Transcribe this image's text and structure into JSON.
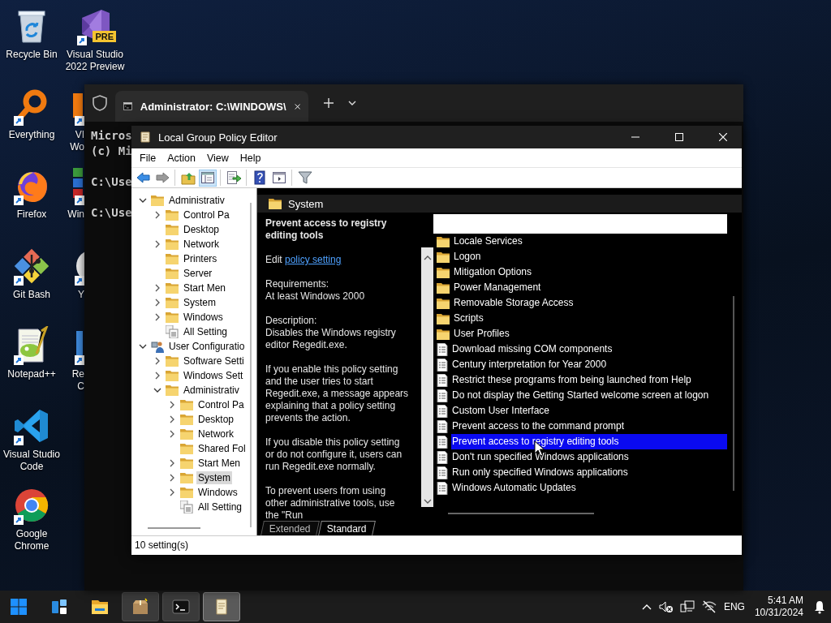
{
  "desktop": {
    "icons": [
      {
        "lines": [
          "Recycle Bin"
        ],
        "kind": "recycle-bin",
        "shortcut": false
      },
      {
        "lines": [
          "Everything"
        ],
        "kind": "everything",
        "shortcut": true
      },
      {
        "lines": [
          "Firefox"
        ],
        "kind": "firefox",
        "shortcut": true
      },
      {
        "lines": [
          "Git Bash"
        ],
        "kind": "git-bash",
        "shortcut": true
      },
      {
        "lines": [
          "Notepad++"
        ],
        "kind": "notepad-plus",
        "shortcut": true
      },
      {
        "lines": [
          "Visual Studio",
          "Code"
        ],
        "kind": "vscode",
        "shortcut": true
      },
      {
        "lines": [
          "Google",
          "Chrome"
        ],
        "kind": "chrome",
        "shortcut": true
      }
    ],
    "second_column": [
      {
        "lines": [
          "Visual Studio",
          "2022 Preview"
        ],
        "kind": "vs-preview",
        "badge": "PRE",
        "shortcut": true
      }
    ],
    "covered_icons": [
      {
        "lines": [
          "VI",
          "Wo"
        ],
        "kind": "ring",
        "shortcut": true
      },
      {
        "lines": [
          "Win"
        ],
        "kind": "tiles",
        "shortcut": true
      },
      {
        "lines": [
          "Y"
        ],
        "kind": "disc",
        "shortcut": true
      },
      {
        "lines": [
          "Re",
          "C"
        ],
        "kind": "panel",
        "shortcut": true
      }
    ]
  },
  "terminal": {
    "tab_title": "Administrator: C:\\WINDOWS\\",
    "blocks": [
      [
        "Micros",
        "(c) Mi"
      ],
      [
        "C:\\Use"
      ],
      [
        "C:\\Use"
      ]
    ]
  },
  "gpo": {
    "title": "Local Group Policy Editor",
    "menu": [
      "File",
      "Action",
      "View",
      "Help"
    ],
    "toolbar": [
      [
        {
          "kind": "back",
          "pressed": false
        },
        {
          "kind": "forward",
          "pressed": false
        }
      ],
      [
        {
          "kind": "up",
          "pressed": false
        },
        {
          "kind": "tree-toggle",
          "pressed": true
        }
      ],
      [
        {
          "kind": "export",
          "pressed": false
        }
      ],
      [
        {
          "kind": "help",
          "pressed": false
        },
        {
          "kind": "view",
          "pressed": false
        }
      ],
      [
        {
          "kind": "filter",
          "pressed": false
        }
      ]
    ],
    "tree": [
      {
        "label": "Administrativ",
        "kind": "folder",
        "expanded": true,
        "selected": false,
        "children": [
          {
            "label": "Control Pa",
            "kind": "folder",
            "expanded": false,
            "selected": false
          },
          {
            "label": "Desktop",
            "kind": "folder",
            "selected": false
          },
          {
            "label": "Network",
            "kind": "folder",
            "expanded": false,
            "selected": false
          },
          {
            "label": "Printers",
            "kind": "folder",
            "selected": false
          },
          {
            "label": "Server",
            "kind": "folder",
            "selected": false
          },
          {
            "label": "Start Men",
            "kind": "folder",
            "expanded": false,
            "selected": false
          },
          {
            "label": "System",
            "kind": "folder",
            "expanded": false,
            "selected": false
          },
          {
            "label": "Windows",
            "kind": "folder",
            "expanded": false,
            "selected": false
          },
          {
            "label": "All Setting",
            "kind": "all-settings",
            "selected": false
          }
        ]
      },
      {
        "label": "User Configuratio",
        "kind": "user",
        "expanded": true,
        "selected": false,
        "children": [
          {
            "label": "Software Setti",
            "kind": "folder",
            "expanded": false,
            "selected": false
          },
          {
            "label": "Windows Sett",
            "kind": "folder",
            "expanded": false,
            "selected": false
          },
          {
            "label": "Administrativ",
            "kind": "folder",
            "expanded": true,
            "selected": false,
            "children": [
              {
                "label": "Control Pa",
                "kind": "folder",
                "expanded": false,
                "selected": false
              },
              {
                "label": "Desktop",
                "kind": "folder",
                "expanded": false,
                "selected": false
              },
              {
                "label": "Network",
                "kind": "folder",
                "expanded": false,
                "selected": false
              },
              {
                "label": "Shared Fol",
                "kind": "folder",
                "selected": false
              },
              {
                "label": "Start Men",
                "kind": "folder",
                "expanded": false,
                "selected": false
              },
              {
                "label": "System",
                "kind": "folder",
                "expanded": false,
                "selected": true
              },
              {
                "label": "Windows",
                "kind": "folder",
                "expanded": false,
                "selected": false
              },
              {
                "label": "All Setting",
                "kind": "all-settings",
                "selected": false
              }
            ]
          }
        ]
      }
    ],
    "header": "System",
    "details": {
      "title": "Prevent access to registry editing tools",
      "edit": "Edit",
      "link": "policy setting",
      "sections": [
        {
          "heading": "Requirements:",
          "text": "At least Windows 2000"
        },
        {
          "heading": "Description:",
          "text": "Disables the Windows registry editor Regedit.exe."
        }
      ],
      "paragraphs": [
        "If you enable this policy setting and the user tries to start Regedit.exe, a message appears explaining that a policy setting prevents the action.",
        "If you disable this policy setting or do not configure it, users can run Regedit.exe normally.",
        "To prevent users from using other administrative tools, use the \"Run"
      ]
    },
    "items": [
      {
        "label": "Locale Services",
        "kind": "folder",
        "selected": false
      },
      {
        "label": "Logon",
        "kind": "folder",
        "selected": false
      },
      {
        "label": "Mitigation Options",
        "kind": "folder",
        "selected": false
      },
      {
        "label": "Power Management",
        "kind": "folder",
        "selected": false
      },
      {
        "label": "Removable Storage Access",
        "kind": "folder",
        "selected": false
      },
      {
        "label": "Scripts",
        "kind": "folder",
        "selected": false
      },
      {
        "label": "User Profiles",
        "kind": "folder",
        "selected": false
      },
      {
        "label": "Download missing COM components",
        "kind": "setting",
        "selected": false
      },
      {
        "label": "Century interpretation for Year 2000",
        "kind": "setting",
        "selected": false
      },
      {
        "label": "Restrict these programs from being launched from Help",
        "kind": "setting",
        "selected": false
      },
      {
        "label": "Do not display the Getting Started welcome screen at logon",
        "kind": "setting",
        "selected": false
      },
      {
        "label": "Custom User Interface",
        "kind": "setting",
        "selected": false
      },
      {
        "label": "Prevent access to the command prompt",
        "kind": "setting",
        "selected": false
      },
      {
        "label": "Prevent access to registry editing tools",
        "kind": "setting",
        "selected": true
      },
      {
        "label": "Don't run specified Windows applications",
        "kind": "setting",
        "selected": false
      },
      {
        "label": "Run only specified Windows applications",
        "kind": "setting",
        "selected": false
      },
      {
        "label": "Windows Automatic Updates",
        "kind": "setting",
        "selected": false
      }
    ],
    "tabs": [
      {
        "label": "Extended",
        "selected": false
      },
      {
        "label": "Standard",
        "selected": true
      }
    ],
    "status": "10 setting(s)"
  },
  "taskbar": {
    "apps": [
      {
        "kind": "start",
        "open": false,
        "selected": false
      },
      {
        "kind": "widgets",
        "open": false,
        "selected": false
      },
      {
        "kind": "explorer",
        "open": false,
        "selected": false
      },
      {
        "kind": "archive",
        "open": true,
        "selected": false
      },
      {
        "kind": "terminal",
        "open": true,
        "selected": false
      },
      {
        "kind": "policy-editor",
        "open": true,
        "selected": true
      }
    ],
    "language": "ENG",
    "time": "5:41 AM",
    "date": "10/31/2024"
  }
}
